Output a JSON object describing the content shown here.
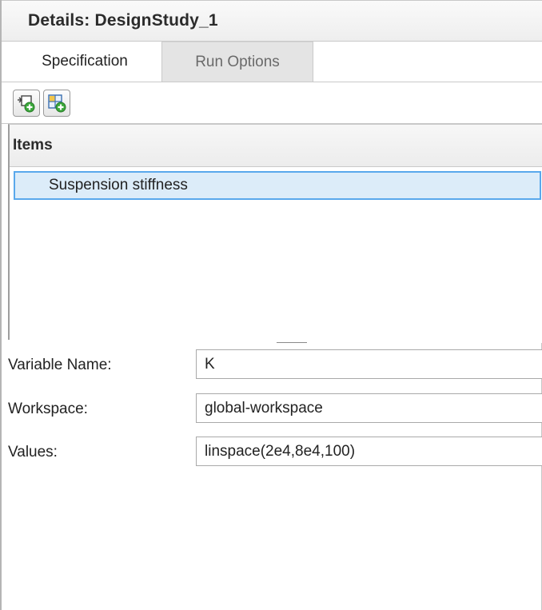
{
  "title": "Details: DesignStudy_1",
  "tabs": [
    {
      "label": "Specification",
      "active": true
    },
    {
      "label": "Run Options",
      "active": false
    }
  ],
  "toolbar": {
    "buttons": [
      {
        "icon": "add-variable-icon"
      },
      {
        "icon": "add-grid-icon"
      }
    ]
  },
  "items": {
    "header": "Items",
    "rows": [
      {
        "label": "Suspension stiffness",
        "selected": true
      }
    ]
  },
  "properties": {
    "variable_name": {
      "label": "Variable Name:",
      "value": "K"
    },
    "workspace": {
      "label": "Workspace:",
      "value": "global-workspace"
    },
    "values": {
      "label": "Values:",
      "value": "linspace(2e4,8e4,100)"
    }
  },
  "colors": {
    "selection_fill": "#dcecf9",
    "selection_border": "#59a8ec",
    "icon_green": "#3aa83a"
  }
}
